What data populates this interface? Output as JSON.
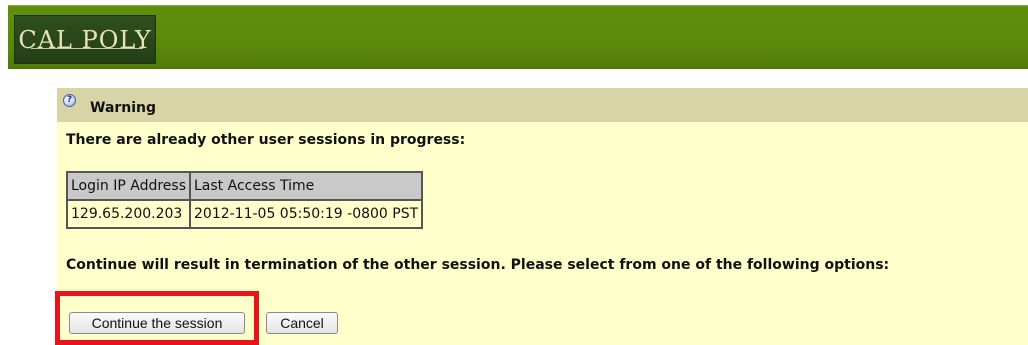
{
  "header": {
    "logo_text": "CAL POLY"
  },
  "warning": {
    "icon": "question-icon",
    "title": "Warning",
    "message": "There are already other user sessions in progress:",
    "table": {
      "headers": [
        "Login IP Address",
        "Last Access Time"
      ],
      "rows": [
        [
          "129.65.200.203",
          "2012-11-05 05:50:19 -0800 PST"
        ]
      ]
    },
    "instruction": "Continue will result in termination of the other session. Please select from one of the following options:"
  },
  "actions": {
    "continue_label": "Continue the session",
    "cancel_label": "Cancel"
  },
  "colors": {
    "header_green": "#5b8a0a",
    "logo_bg": "#2f4f1f",
    "panel_bg": "#ffffcc",
    "panel_header_bg": "#d9d4a6",
    "highlight": "#e8141a"
  }
}
